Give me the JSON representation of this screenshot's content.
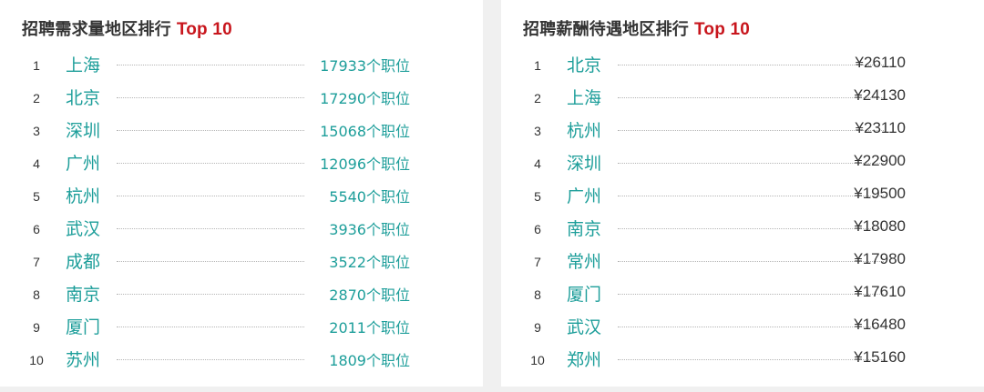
{
  "demand_ranking": {
    "title": "招聘需求量地区排行",
    "badge": "Top 10",
    "items": [
      {
        "rank": "1",
        "city": "上海",
        "value": "17933个职位"
      },
      {
        "rank": "2",
        "city": "北京",
        "value": "17290个职位"
      },
      {
        "rank": "3",
        "city": "深圳",
        "value": "15068个职位"
      },
      {
        "rank": "4",
        "city": "广州",
        "value": "12096个职位"
      },
      {
        "rank": "5",
        "city": "杭州",
        "value": "5540个职位"
      },
      {
        "rank": "6",
        "city": "武汉",
        "value": "3936个职位"
      },
      {
        "rank": "7",
        "city": "成都",
        "value": "3522个职位"
      },
      {
        "rank": "8",
        "city": "南京",
        "value": "2870个职位"
      },
      {
        "rank": "9",
        "city": "厦门",
        "value": "2011个职位"
      },
      {
        "rank": "10",
        "city": "苏州",
        "value": "1809个职位"
      }
    ]
  },
  "salary_ranking": {
    "title": "招聘薪酬待遇地区排行",
    "badge": "Top 10",
    "items": [
      {
        "rank": "1",
        "city": "北京",
        "value": "¥26110"
      },
      {
        "rank": "2",
        "city": "上海",
        "value": "¥24130"
      },
      {
        "rank": "3",
        "city": "杭州",
        "value": "¥23110"
      },
      {
        "rank": "4",
        "city": "深圳",
        "value": "¥22900"
      },
      {
        "rank": "5",
        "city": "广州",
        "value": "¥19500"
      },
      {
        "rank": "6",
        "city": "南京",
        "value": "¥18080"
      },
      {
        "rank": "7",
        "city": "常州",
        "value": "¥17980"
      },
      {
        "rank": "8",
        "city": "厦门",
        "value": "¥17610"
      },
      {
        "rank": "9",
        "city": "武汉",
        "value": "¥16480"
      },
      {
        "rank": "10",
        "city": "郑州",
        "value": "¥15160"
      }
    ]
  },
  "colors": {
    "city_text": "#1d9e9a",
    "badge": "#c8161d",
    "title_text": "#333333"
  }
}
